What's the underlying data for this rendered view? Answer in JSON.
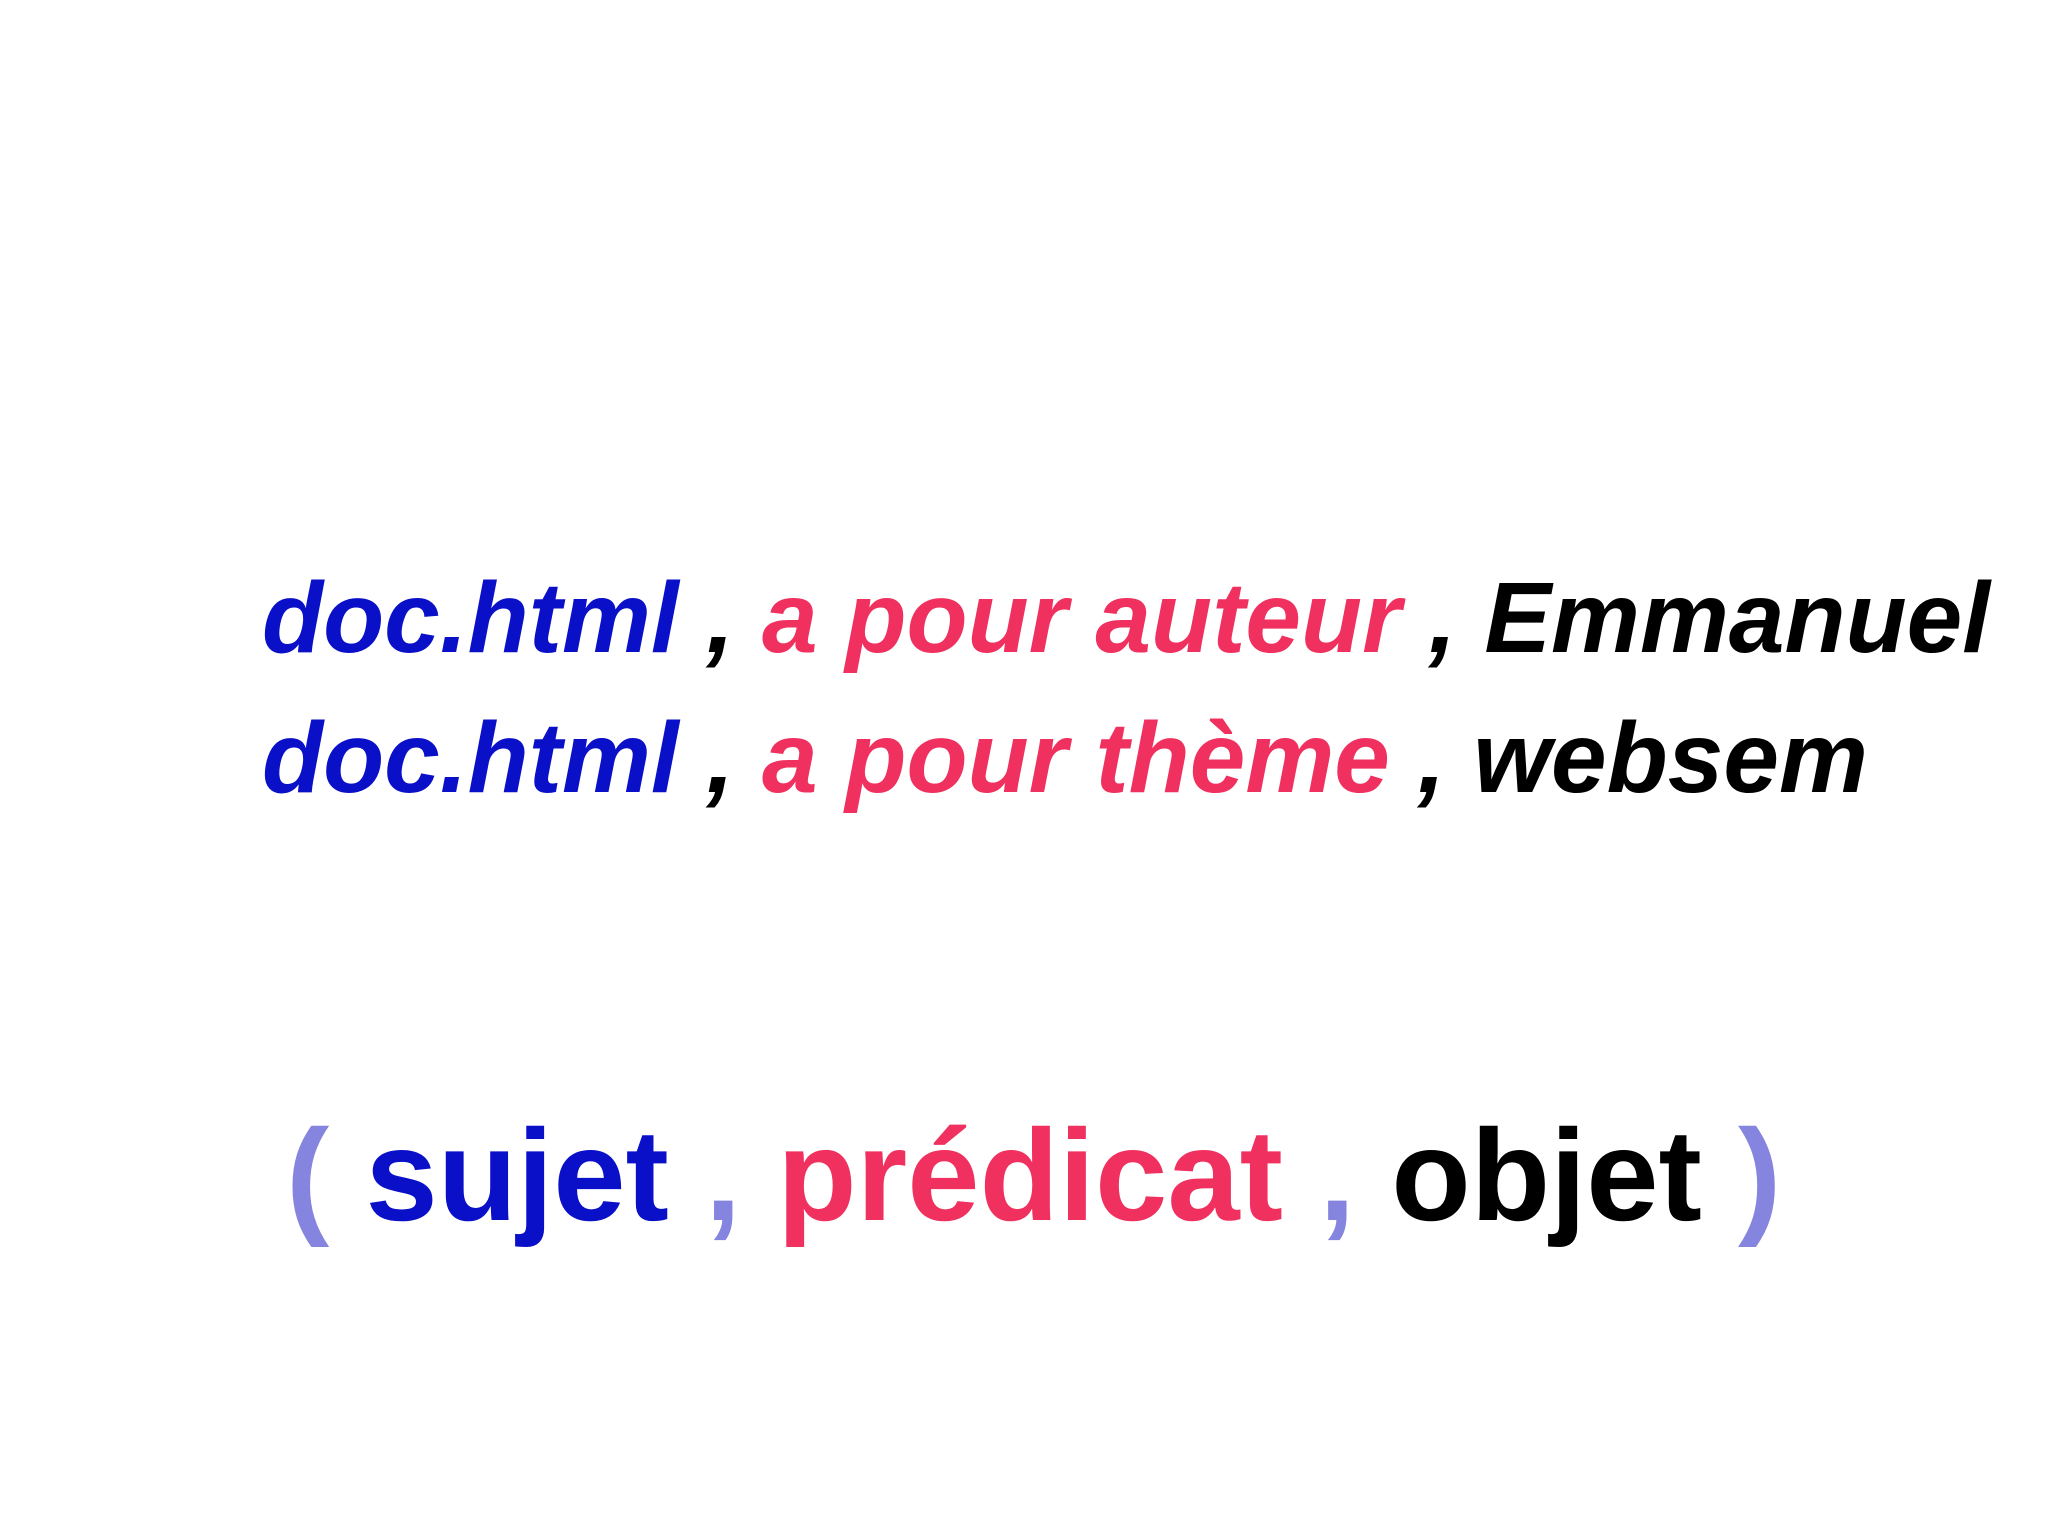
{
  "colors": {
    "subject": "#0a0fc8",
    "predicate": "#f0305e",
    "object": "#000000",
    "delimiter": "#8585e0"
  },
  "triples": [
    {
      "subject": "doc.html",
      "comma1": " , ",
      "predicate": "a pour auteur",
      "comma2": " , ",
      "object": "Emmanuel"
    },
    {
      "subject": "doc.html",
      "comma1": " , ",
      "predicate": "a pour thème",
      "comma2": " , ",
      "object": "websem"
    }
  ],
  "pattern": {
    "open_paren": "(",
    "subject": "sujet",
    "sep1": ",",
    "predicate": "prédicat",
    "sep2": ",",
    "object": "objet",
    "close_paren": ")"
  }
}
